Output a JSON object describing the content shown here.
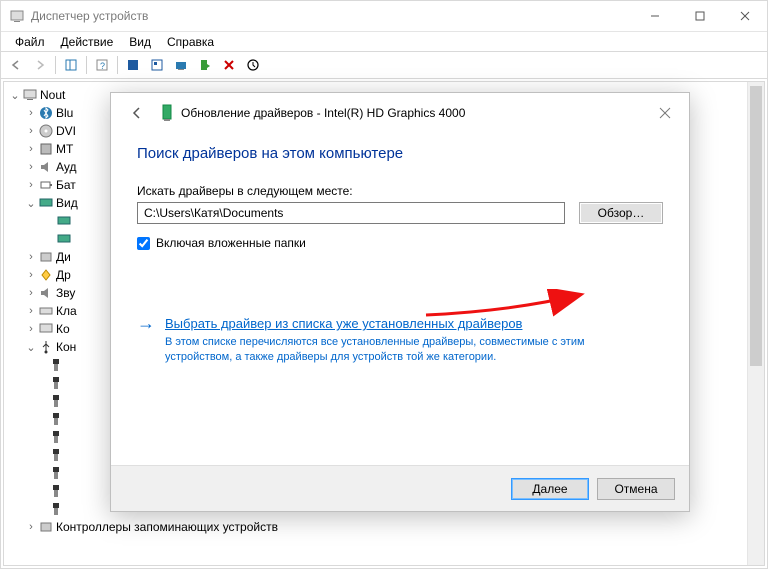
{
  "window": {
    "title": "Диспетчер устройств"
  },
  "menu": {
    "file": "Файл",
    "action": "Действие",
    "view": "Вид",
    "help": "Справка"
  },
  "tree": {
    "root": "Nout",
    "items": {
      "bluetooth": "Blu",
      "dvd": "DVI",
      "mt": "MT",
      "audio": "Ауд",
      "battery": "Бат",
      "video": "Вид"
    },
    "disk": "Ди",
    "other": "Др",
    "sound": "Зву",
    "keyboard": "Кла",
    "computer": "Ко",
    "controllers": "Кон",
    "storage_controllers": "Контроллеры запоминающих устройств"
  },
  "dialog": {
    "title": "Обновление драйверов - Intel(R) HD Graphics 4000",
    "heading": "Поиск драйверов на этом компьютере",
    "path_label": "Искать драйверы в следующем месте:",
    "path_value": "C:\\Users\\Катя\\Documents",
    "browse": "Обзор…",
    "include_subfolders": "Включая вложенные папки",
    "link_title": "Выбрать драйвер из списка уже установленных драйверов",
    "link_desc": "В этом списке перечисляются все установленные драйверы, совместимые с этим устройством, а также драйверы для устройств той же категории.",
    "next": "Далее",
    "cancel": "Отмена"
  }
}
